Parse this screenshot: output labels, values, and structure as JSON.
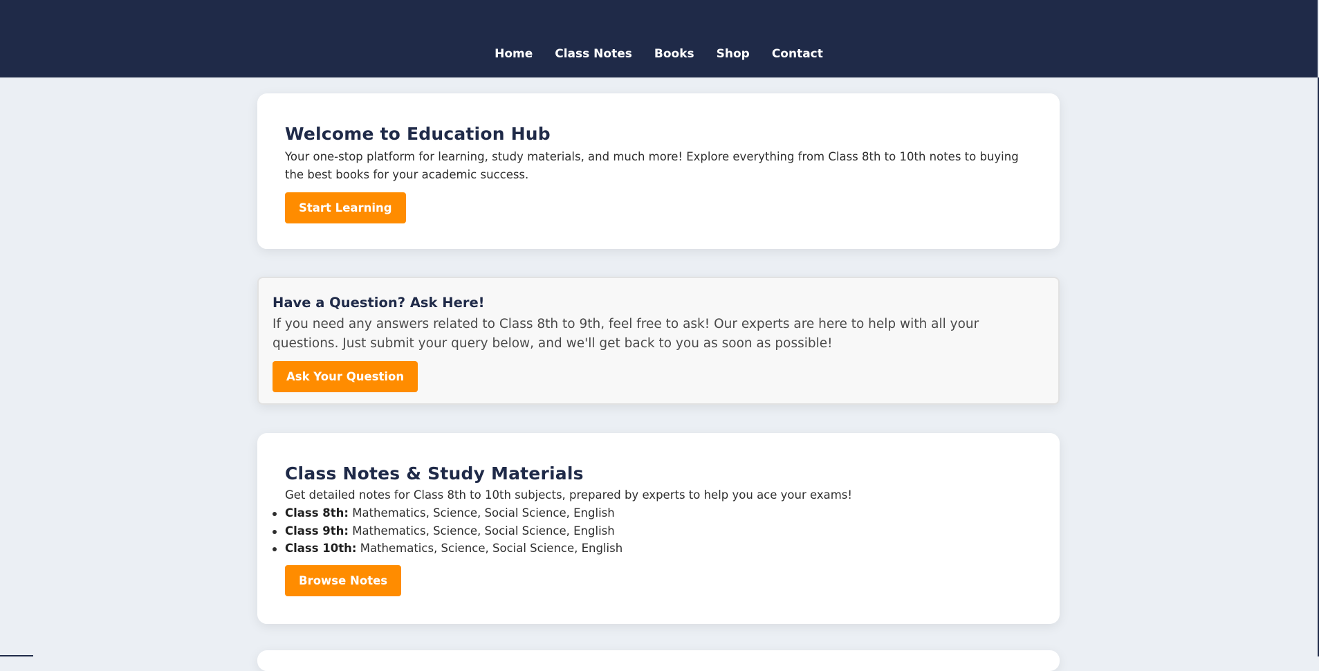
{
  "nav": {
    "items": [
      "Home",
      "Class Notes",
      "Books",
      "Shop",
      "Contact"
    ]
  },
  "hero": {
    "title": "Welcome to Education Hub",
    "description": "Your one-stop platform for learning, study materials, and much more! Explore everything from Class 8th to 10th notes to buying the best books for your academic success.",
    "button_label": "Start Learning"
  },
  "ask": {
    "title": "Have a Question? Ask Here!",
    "description": "If you need any answers related to Class 8th to 9th, feel free to ask! Our experts are here to help with all your questions. Just submit your query below, and we'll get back to you as soon as possible!",
    "button_label": "Ask Your Question"
  },
  "notes": {
    "title": "Class Notes & Study Materials",
    "description": "Get detailed notes for Class 8th to 10th subjects, prepared by experts to help you ace your exams!",
    "classes": [
      {
        "label": "Class 8th:",
        "subjects": " Mathematics, Science, Social Science, English"
      },
      {
        "label": "Class 9th:",
        "subjects": " Mathematics, Science, Social Science, English"
      },
      {
        "label": "Class 10th:",
        "subjects": " Mathematics, Science, Social Science, English"
      }
    ],
    "button_label": "Browse Notes"
  },
  "colors": {
    "header_bg": "#1f2a48",
    "accent": "#ff8c00",
    "page_bg": "#ebeff4"
  }
}
